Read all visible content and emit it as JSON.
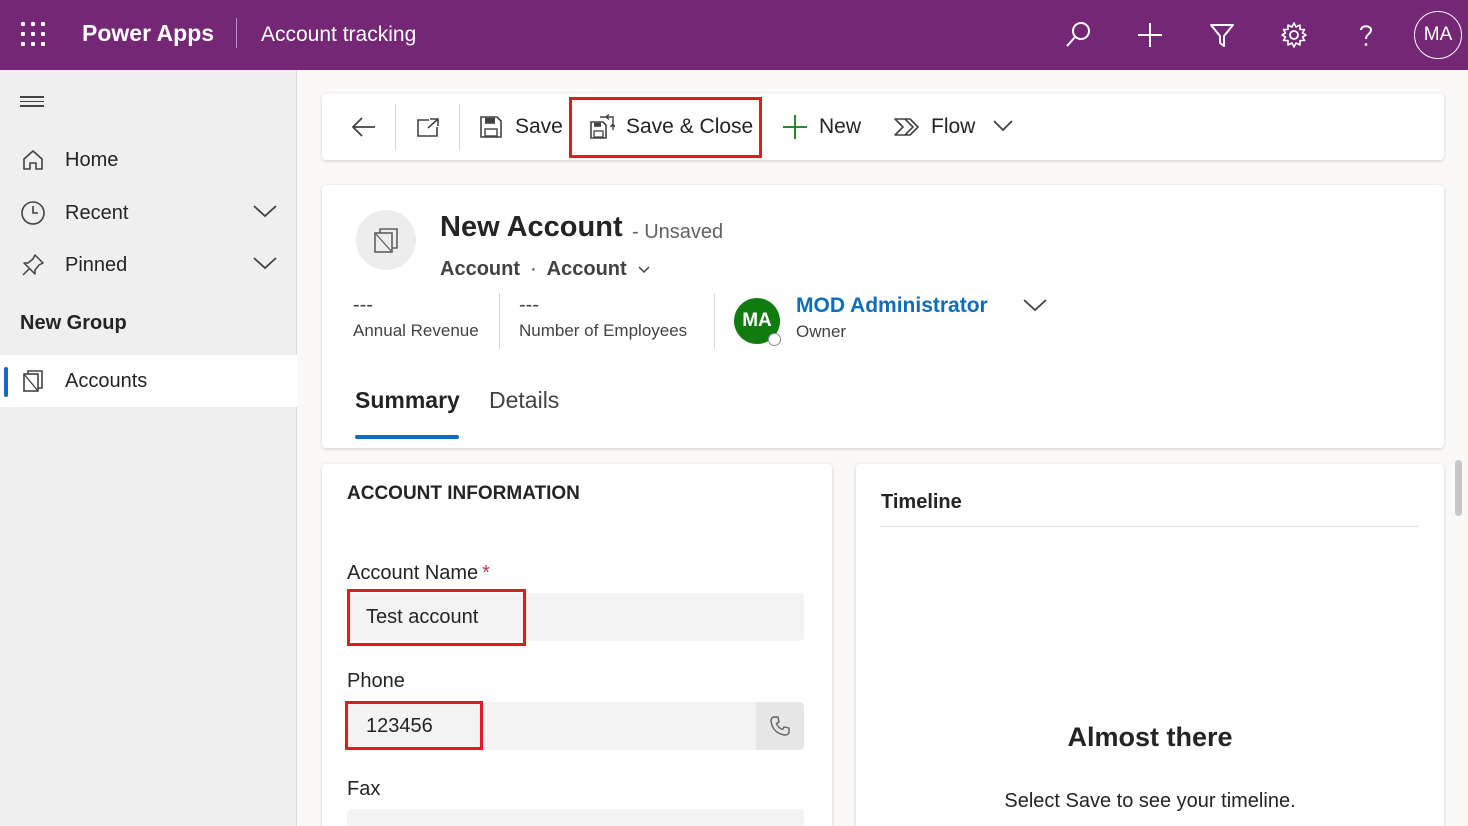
{
  "app": {
    "name": "Power Apps",
    "page": "Account tracking",
    "user_initials": "MA"
  },
  "sidebar": {
    "items": [
      {
        "label": "Home"
      },
      {
        "label": "Recent"
      },
      {
        "label": "Pinned"
      }
    ],
    "group_title": "New Group",
    "group_items": [
      {
        "label": "Accounts"
      }
    ]
  },
  "toolbar": {
    "save_label": "Save",
    "save_close_label": "Save & Close",
    "new_label": "New",
    "flow_label": "Flow"
  },
  "record": {
    "title": "New Account",
    "status": "- Unsaved",
    "entity": "Account",
    "form": "Account",
    "fields": [
      {
        "value": "---",
        "label": "Annual Revenue"
      },
      {
        "value": "---",
        "label": "Number of Employees"
      }
    ],
    "owner": {
      "initials": "MA",
      "name": "MOD Administrator",
      "label": "Owner"
    },
    "tabs": [
      {
        "label": "Summary"
      },
      {
        "label": "Details"
      }
    ]
  },
  "account_info": {
    "section_title": "ACCOUNT INFORMATION",
    "account_name_label": "Account Name",
    "required_mark": "*",
    "account_name_value": "Test account",
    "phone_label": "Phone",
    "phone_value": "123456",
    "fax_label": "Fax"
  },
  "timeline": {
    "title": "Timeline",
    "heading": "Almost there",
    "message": "Select Save to see your timeline."
  },
  "colors": {
    "brand": "#742774",
    "accent": "#0f6cbd",
    "highlight": "#e01b24",
    "owner_avatar": "#107c10"
  }
}
